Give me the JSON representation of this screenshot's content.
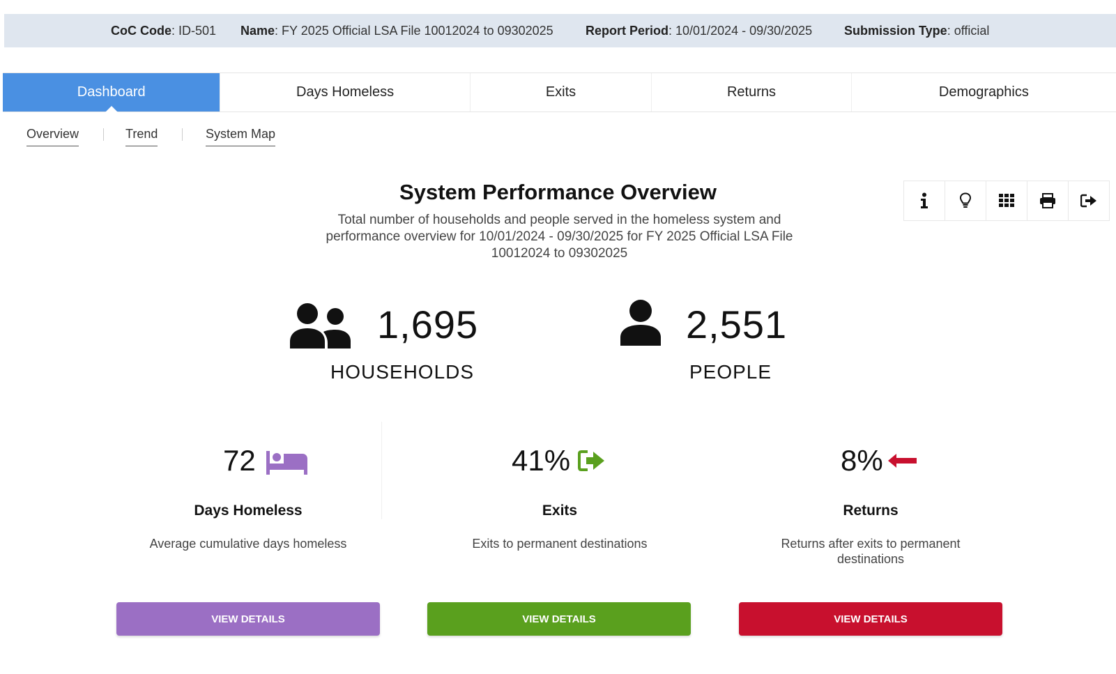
{
  "info_bar": {
    "coc_code_label": "CoC Code",
    "coc_code_value": ": ID-501",
    "name_label": "Name",
    "name_value": ": FY 2025 Official LSA File 10012024 to 09302025",
    "report_period_label": "Report Period",
    "report_period_value": ": 10/01/2024 - 09/30/2025",
    "submission_type_label": "Submission Type",
    "submission_type_value": ": official"
  },
  "tabs": [
    {
      "label": "Dashboard",
      "active": true
    },
    {
      "label": "Days Homeless"
    },
    {
      "label": "Exits"
    },
    {
      "label": "Returns"
    },
    {
      "label": "Demographics"
    }
  ],
  "subnav": [
    {
      "label": "Overview"
    },
    {
      "label": "Trend"
    },
    {
      "label": "System Map"
    }
  ],
  "overview": {
    "title": "System Performance Overview",
    "subtitle": "Total number of households and people served in the homeless system and performance overview for 10/01/2024 - 09/30/2025 for FY 2025 Official LSA File 10012024 to 09302025"
  },
  "toolbar": {
    "icons": [
      "info-icon",
      "lightbulb-icon",
      "grid-icon",
      "print-icon",
      "export-icon"
    ]
  },
  "stats": {
    "households": {
      "value": "1,695",
      "label": "HOUSEHOLDS",
      "icon": "users-icon"
    },
    "people": {
      "value": "2,551",
      "label": "PEOPLE",
      "icon": "user-icon"
    }
  },
  "metrics": {
    "days_homeless": {
      "value": "72",
      "title": "Days Homeless",
      "desc": "Average cumulative days homeless",
      "button": "VIEW DETAILS",
      "color": "#9b6fc4",
      "icon": "bed-icon"
    },
    "exits": {
      "value": "41%",
      "title": "Exits",
      "desc": "Exits to permanent destinations",
      "button": "VIEW DETAILS",
      "color": "#5aa01e",
      "icon": "sign-out-icon"
    },
    "returns": {
      "value": "8%",
      "title": "Returns",
      "desc": "Returns after exits to permanent destinations",
      "button": "VIEW DETAILS",
      "color": "#c8102e",
      "icon": "arrow-left-icon"
    }
  }
}
